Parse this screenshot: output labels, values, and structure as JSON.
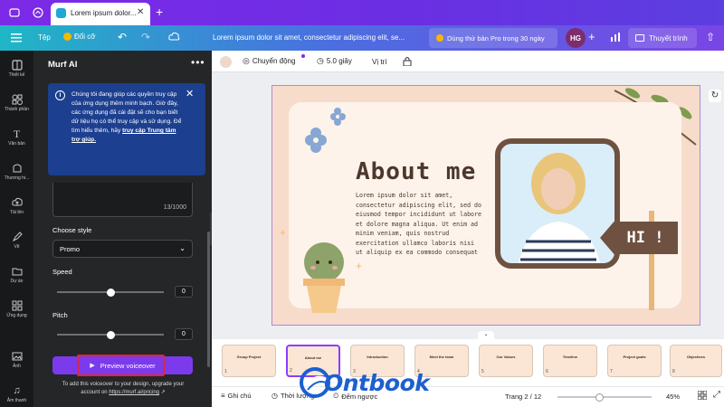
{
  "browser": {
    "tab_title": "Lorem ipsum dolor..."
  },
  "toolbar": {
    "file_label": "Tệp",
    "resize_label": "Đổi cỡ",
    "doc_title": "Lorem ipsum dolor sit amet, consectetur adipiscing elit, se...",
    "pro_trial_label": "Dùng thử bản Pro trong 30 ngày",
    "avatar_initials": "HG",
    "present_label": "Thuyết trình"
  },
  "rail": {
    "items": [
      {
        "label": "Thiết kế",
        "icon": "layout-icon"
      },
      {
        "label": "Thành phần",
        "icon": "shapes-icon"
      },
      {
        "label": "Văn bản",
        "icon": "text-icon"
      },
      {
        "label": "Thương hi...",
        "icon": "brand-icon"
      },
      {
        "label": "Tải lên",
        "icon": "upload-icon"
      },
      {
        "label": "Vẽ",
        "icon": "draw-icon"
      },
      {
        "label": "Dự án",
        "icon": "folder-icon"
      },
      {
        "label": "Ứng dụng",
        "icon": "apps-icon"
      },
      {
        "label": "Ảnh",
        "icon": "photo-icon"
      },
      {
        "label": "Âm thanh",
        "icon": "music-icon"
      }
    ]
  },
  "panel": {
    "title": "Murf AI",
    "notice_text": "Chúng tôi đang giúp các quyền truy cập của ứng dụng thêm minh bạch. Giờ đây, các ứng dụng đã cài đặt sẽ cho bạn biết dữ liệu họ có thể truy cập và sử dụng. Để tìm hiểu thêm, hãy",
    "notice_link": "truy cập Trung tâm trợ giúp.",
    "char_count": "13/1000",
    "style_label": "Choose style",
    "style_value": "Promo",
    "speed_label": "Speed",
    "speed_value": "0",
    "speed_level": 0.5,
    "pitch_label": "Pitch",
    "pitch_value": "0",
    "pitch_level": 0.5,
    "preview_button": "Preview voiceover",
    "footer_text": "To add this voiceover to your design, upgrade your account on",
    "footer_link": "https://murf.ai/pricing"
  },
  "editor_bar": {
    "animate_label": "Chuyển động",
    "duration_label": "5.0 giây",
    "position_label": "Vị trí"
  },
  "slide": {
    "heading": "About me",
    "body": "Lorem ipsum dolor sit amet, consectetur adipiscing elit, sed do eiusmod tempor incididunt ut labore et dolore magna aliqua. Ut enim ad minim veniam, quis nostrud exercitation ullamco laboris nisi ut aliquip ex ea commodo consequat",
    "sign_text": "HI !"
  },
  "thumbnails": [
    {
      "num": "1",
      "title": "Group Project"
    },
    {
      "num": "2",
      "title": "About me"
    },
    {
      "num": "3",
      "title": "Introduction"
    },
    {
      "num": "4",
      "title": "Meet the team"
    },
    {
      "num": "5",
      "title": "Our Values"
    },
    {
      "num": "6",
      "title": "Timeline"
    },
    {
      "num": "7",
      "title": "Project goals"
    },
    {
      "num": "8",
      "title": "Objectives"
    }
  ],
  "bottom_bar": {
    "notes_label": "Ghi chú",
    "timer_label": "Thời lượng",
    "count_label": "Đếm ngược",
    "page_label": "Trang 2 / 12",
    "zoom_label": "45%",
    "zoom_level": 0.45
  },
  "watermark": {
    "brand": "Ontbook"
  },
  "colors": {
    "brand_purple": "#7d2ae8",
    "panel_bg": "#252627",
    "notice_bg": "#1d3f8f",
    "button_purple": "#7c3aed",
    "highlight_red": "#e5262a",
    "slide_bg": "#f7dccb",
    "slide_card": "#fdf3ea",
    "heading_brown": "#4b372c",
    "watermark_blue": "#1c5fcf"
  }
}
